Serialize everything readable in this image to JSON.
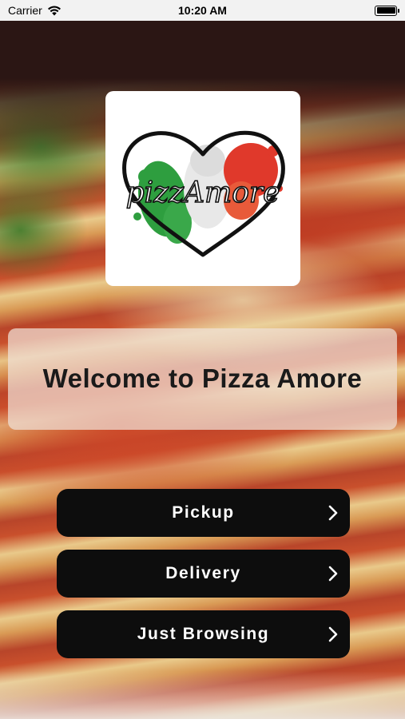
{
  "status_bar": {
    "carrier": "Carrier",
    "time": "10:20 AM",
    "battery_level": 1.0
  },
  "logo": {
    "brand_text": "pizzAmore",
    "colors": {
      "green": "#2e9e3f",
      "white": "#f4f4f4",
      "red": "#e0392b",
      "outline": "#111111"
    }
  },
  "welcome": {
    "title": "Welcome to Pizza Amore"
  },
  "actions": {
    "pickup_label": "Pickup",
    "delivery_label": "Delivery",
    "browsing_label": "Just Browsing",
    "chevron_icon": "chevron-right-icon"
  },
  "theme": {
    "button_bg": "#0d0d0d",
    "button_text": "#ffffff",
    "card_bg": "rgba(240,225,215,0.72)"
  }
}
